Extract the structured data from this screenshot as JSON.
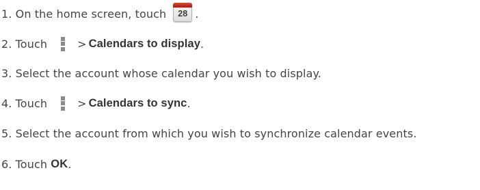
{
  "steps": [
    {
      "num": "1.",
      "text_before": "On the home screen, touch",
      "icon": "calendar-app-icon",
      "icon_text": "28",
      "text_after": "."
    },
    {
      "num": "2.",
      "text_before": "Touch",
      "icon": "menu-icon",
      "gt": ">",
      "bold": "Calendars to display",
      "text_after": "."
    },
    {
      "num": "3.",
      "text": "Select the account whose calendar you wish to display."
    },
    {
      "num": "4.",
      "text_before": "Touch",
      "icon": "menu-icon",
      "gt": ">",
      "bold": "Calendars to sync",
      "text_after": "."
    },
    {
      "num": "5.",
      "text": "Select the account from which you wish to synchronize calendar events."
    },
    {
      "num": "6.",
      "text_before": "Touch",
      "bold": "OK",
      "text_after": "."
    }
  ],
  "colors": {
    "text": "#444444",
    "calendar_header": "#b22a20",
    "menu_icon": "#8a8a8a"
  }
}
